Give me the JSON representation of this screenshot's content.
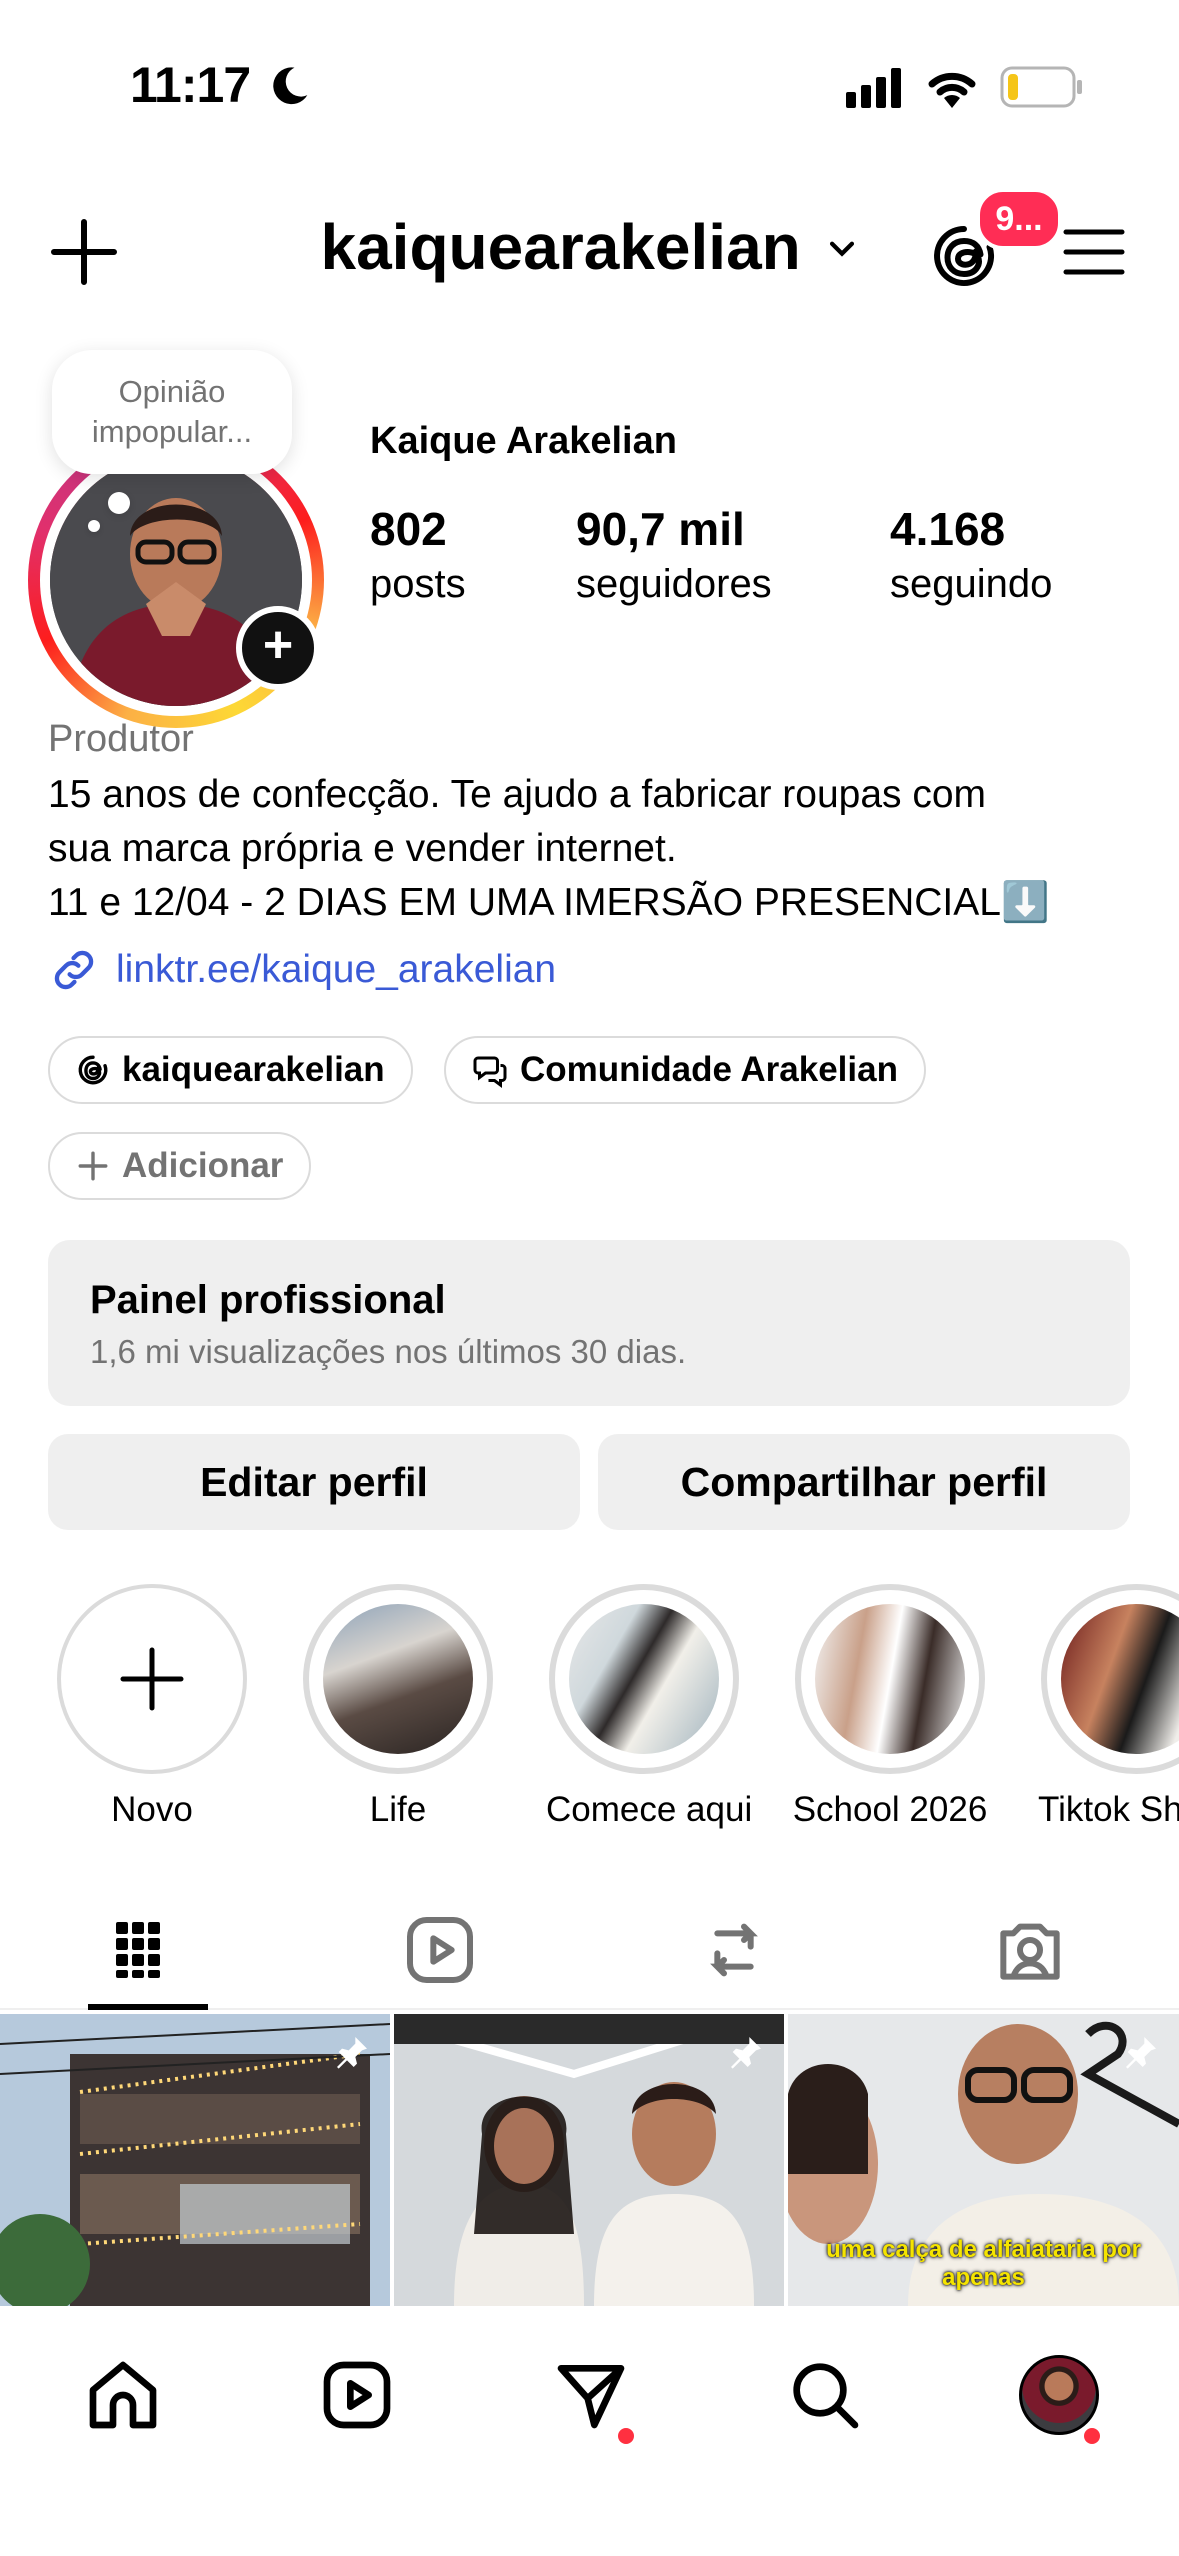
{
  "status_bar": {
    "time": "11:17"
  },
  "header": {
    "username": "kaiquearakelian",
    "notification_badge": "9..."
  },
  "profile": {
    "note": "Opinião impopular...",
    "full_name": "Kaique Arakelian",
    "stats": [
      {
        "value": "802",
        "label": "posts"
      },
      {
        "value": "90,7 mil",
        "label": "seguidores"
      },
      {
        "value": "4.168",
        "label": "seguindo"
      }
    ],
    "category": "Produtor",
    "bio_lines": [
      "15 anos de confecção. Te ajudo a fabricar roupas com",
      "sua marca própria e vender internet.",
      "11 e 12/04 - 2 DIAS EM UMA IMERSÃO PRESENCIAL⬇️"
    ],
    "link": "linktr.ee/kaique_arakelian",
    "pills": {
      "threads": "kaiquearakelian",
      "community": "Comunidade Arakelian",
      "add": "Adicionar"
    }
  },
  "dashboard": {
    "title": "Painel profissional",
    "subtitle": "1,6 mi visualizações nos últimos 30 dias."
  },
  "actions": {
    "edit": "Editar perfil",
    "share": "Compartilhar perfil"
  },
  "highlights": [
    {
      "label": "Novo"
    },
    {
      "label": "Life"
    },
    {
      "label": "Comece aqui"
    },
    {
      "label": "School 2026"
    },
    {
      "label": "Tiktok Sh"
    }
  ],
  "grid": {
    "caption_3": "uma calça de alfaiataria por apenas"
  },
  "colors": {
    "accent_link": "#3a5ad6",
    "badge_red": "#ff2d55",
    "surface": "#efefef",
    "muted_text": "#737373"
  }
}
